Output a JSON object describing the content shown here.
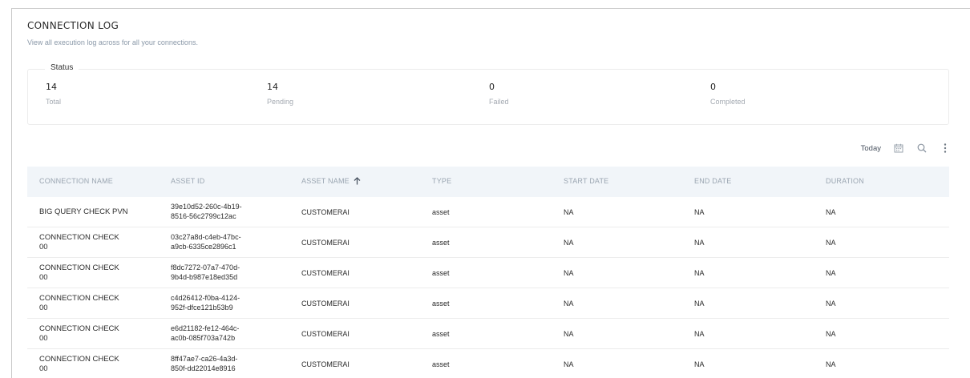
{
  "header": {
    "title": "CONNECTION LOG",
    "subtitle": "View all execution log across for all your connections."
  },
  "status": {
    "legend": "Status",
    "stats": [
      {
        "value": "14",
        "label": "Total"
      },
      {
        "value": "14",
        "label": "Pending"
      },
      {
        "value": "0",
        "label": "Failed"
      },
      {
        "value": "0",
        "label": "Completed"
      }
    ]
  },
  "toolbar": {
    "today_label": "Today",
    "icons": [
      "calendar-icon",
      "search-icon",
      "more-vertical-icon"
    ]
  },
  "table": {
    "columns": [
      "CONNECTION NAME",
      "ASSET ID",
      "ASSET NAME",
      "TYPE",
      "START DATE",
      "END DATE",
      "DURATION"
    ],
    "sorted_column": "ASSET NAME",
    "sort_direction": "ascending",
    "rows": [
      {
        "name": "BIG QUERY CHECK PVN",
        "asset_id": "39e10d52-260c-4b19-8516-56c2799c12ac",
        "asset_id_l1": "39e10d52-260c-4b19-",
        "asset_id_l2": "8516-56c2799c12ac",
        "asset_name": "CUSTOMERAI",
        "type": "asset",
        "start": "NA",
        "end": "NA",
        "duration": "NA"
      },
      {
        "name": "CONNECTION CHECK 00",
        "name_l1": "CONNECTION CHECK",
        "name_l2": "00",
        "asset_id_l1": "03c27a8d-c4eb-47bc-",
        "asset_id_l2": "a9cb-6335ce2896c1",
        "asset_name": "CUSTOMERAI",
        "type": "asset",
        "start": "NA",
        "end": "NA",
        "duration": "NA"
      },
      {
        "name_l1": "CONNECTION CHECK",
        "name_l2": "00",
        "asset_id_l1": "f8dc7272-07a7-470d-",
        "asset_id_l2": "9b4d-b987e18ed35d",
        "asset_name": "CUSTOMERAI",
        "type": "asset",
        "start": "NA",
        "end": "NA",
        "duration": "NA"
      },
      {
        "name_l1": "CONNECTION CHECK",
        "name_l2": "00",
        "asset_id_l1": "c4d26412-f0ba-4124-",
        "asset_id_l2": "952f-dfce121b53b9",
        "asset_name": "CUSTOMERAI",
        "type": "asset",
        "start": "NA",
        "end": "NA",
        "duration": "NA"
      },
      {
        "name_l1": "CONNECTION CHECK",
        "name_l2": "00",
        "asset_id_l1": "e6d21182-fe12-464c-",
        "asset_id_l2": "ac0b-085f703a742b",
        "asset_name": "CUSTOMERAI",
        "type": "asset",
        "start": "NA",
        "end": "NA",
        "duration": "NA"
      },
      {
        "name_l1": "CONNECTION CHECK",
        "name_l2": "00",
        "asset_id_l1": "8ff47ae7-ca26-4a3d-",
        "asset_id_l2": "850f-dd22014e8916",
        "asset_name": "CUSTOMERAI",
        "type": "asset",
        "start": "NA",
        "end": "NA",
        "duration": "NA"
      }
    ]
  }
}
